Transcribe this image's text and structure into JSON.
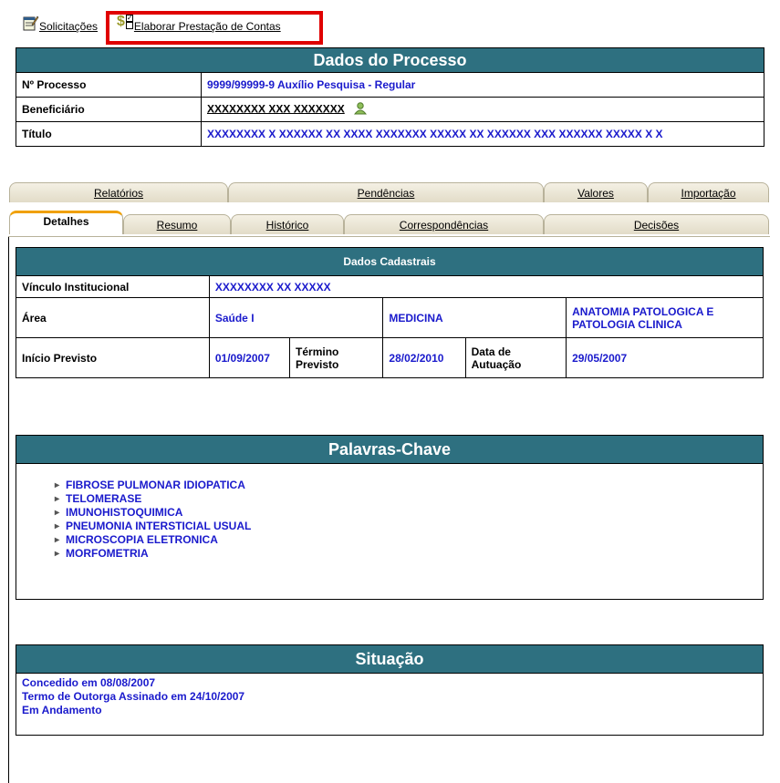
{
  "top": {
    "solicitacoes_label": "Solicitações",
    "elaborar_label": "Elaborar Prestação de Contas",
    "dollar_glyph": "$",
    "highlight_color": "#e00000"
  },
  "processo": {
    "header": "Dados do Processo",
    "rows": [
      {
        "label": "Nº Processo",
        "value": "9999/99999-9 Auxílio Pesquisa - Regular"
      },
      {
        "label": "Beneficiário",
        "value": "XXXXXXXX XXX XXXXXXX"
      },
      {
        "label": "Título",
        "value": "XXXXXXXX X XXXXXX XX XXXX XXXXXXX XXXXX XX XXXXXX XXX XXXXXX XXXXX X X"
      }
    ]
  },
  "tabs": {
    "row1": [
      "Relatórios",
      "Pendências",
      "Valores",
      "Importação"
    ],
    "row2": [
      "Detalhes",
      "Resumo",
      "Histórico",
      "Correspondências",
      "Decisões"
    ],
    "active": "Detalhes"
  },
  "cadastrais": {
    "header": "Dados Cadastrais",
    "vinculo_label": "Vínculo Institucional",
    "vinculo_value": "XXXXXXXX XX XXXXX",
    "area_label": "Área",
    "area_values": [
      "Saúde I",
      "MEDICINA",
      "ANATOMIA PATOLOGICA E PATOLOGIA CLINICA"
    ],
    "inicio_label": "Início Previsto",
    "inicio_value": "01/09/2007",
    "termino_label": "Término Previsto",
    "termino_value": "28/02/2010",
    "atuacao_label": "Data de Autuação",
    "atuacao_value": "29/05/2007"
  },
  "palavras": {
    "header": "Palavras-Chave",
    "items": [
      "FIBROSE PULMONAR IDIOPATICA",
      "TELOMERASE",
      "IMUNOHISTOQUIMICA",
      "PNEUMONIA INTERSTICIAL USUAL",
      "MICROSCOPIA ELETRONICA",
      "MORFOMETRIA"
    ]
  },
  "situacao": {
    "header": "Situação",
    "lines": [
      "Concedido em 08/08/2007",
      "Termo de Outorga Assinado em 24/10/2007",
      "Em Andamento"
    ]
  },
  "colors": {
    "header_bg": "#2e7080",
    "value_text": "#1a1acc",
    "tab_active_accent": "#f0a000"
  }
}
